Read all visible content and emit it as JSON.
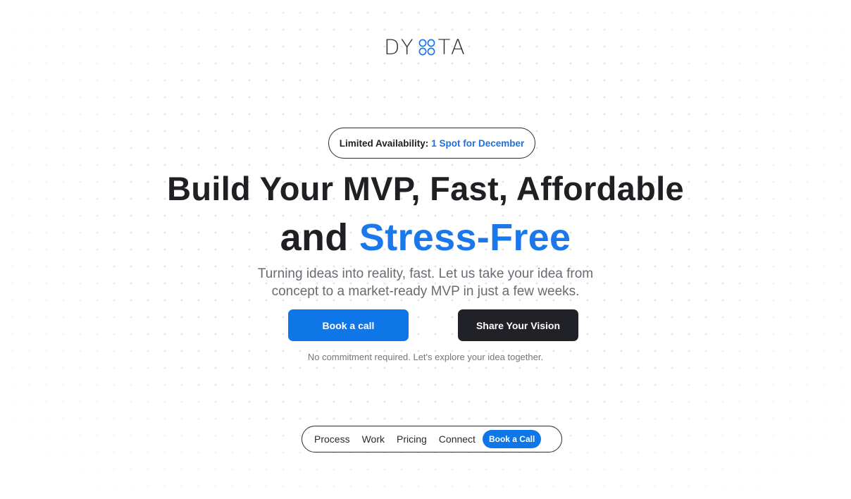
{
  "brand": {
    "logo_left": "DY",
    "logo_right": "TA",
    "logo_mark_icon": "four-circles-icon",
    "accent_color": "#1a78ea",
    "dark_color": "#212228"
  },
  "availability": {
    "label": "Limited Availability:",
    "value": "1 Spot for December"
  },
  "hero": {
    "headline_line1": "Build Your MVP, Fast, Affordable",
    "headline_line2_plain": "and",
    "headline_line2_accent": "Stress-Free",
    "subtitle_line1": "Turning ideas into reality, fast. Let us take your idea from",
    "subtitle_line2": "concept to a market-ready MVP in just a few weeks."
  },
  "cta": {
    "primary_label": "Book a call",
    "secondary_label": "Share Your Vision",
    "note": "No commitment required. Let's explore your idea together."
  },
  "nav": {
    "items": [
      "Process",
      "Work",
      "Pricing",
      "Connect"
    ],
    "cta_label": "Book a Call"
  }
}
